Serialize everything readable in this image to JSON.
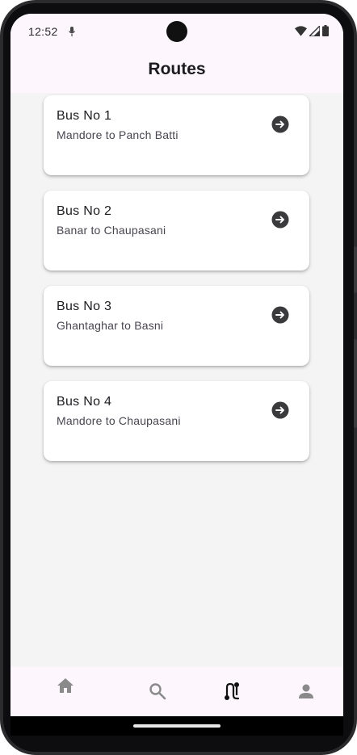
{
  "status_bar": {
    "time": "12:52",
    "icons": [
      "mic-icon",
      "wifi-icon",
      "signal-icon",
      "battery-icon"
    ]
  },
  "appbar": {
    "title": "Routes"
  },
  "routes": [
    {
      "title": "Bus No 1",
      "subtitle": "Mandore to Panch Batti",
      "icon": "arrow-circle-right-icon"
    },
    {
      "title": "Bus No 2",
      "subtitle": "Banar to Chaupasani",
      "icon": "arrow-circle-right-icon"
    },
    {
      "title": "Bus No 3",
      "subtitle": "Ghantaghar to Basni",
      "icon": "arrow-circle-right-icon"
    },
    {
      "title": "Bus No 4",
      "subtitle": "Mandore to Chaupasani",
      "icon": "arrow-circle-right-icon"
    }
  ],
  "bottom_nav": {
    "items": [
      {
        "icon": "home-icon",
        "active": false
      },
      {
        "icon": "search-icon",
        "active": false
      },
      {
        "icon": "route-icon",
        "active": true
      },
      {
        "icon": "person-icon",
        "active": false
      }
    ]
  },
  "colors": {
    "appbar_bg": "#fdf6fd",
    "content_bg": "#f4f4f4",
    "card_bg": "#ffffff",
    "text_primary": "#1c1b1f",
    "text_secondary": "#49454f",
    "icon_dark": "#3a3a3c",
    "icon_inactive": "#8a8a8a",
    "icon_active": "#111111"
  }
}
